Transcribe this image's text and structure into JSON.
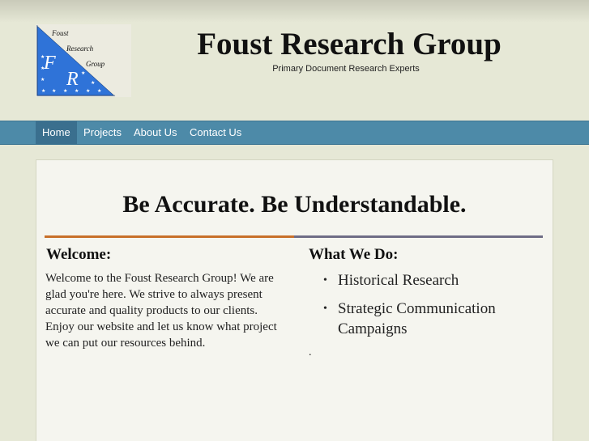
{
  "header": {
    "logo_letters": [
      "F",
      "R"
    ],
    "logo_words": [
      "Foust",
      "Research",
      "Group"
    ],
    "title": "Foust Research Group",
    "tagline": "Primary Document Research Experts"
  },
  "nav": {
    "items": [
      {
        "label": "Home",
        "active": true
      },
      {
        "label": "Projects",
        "active": false
      },
      {
        "label": "About Us",
        "active": false
      },
      {
        "label": "Contact Us",
        "active": false
      }
    ]
  },
  "main": {
    "headline": "Be Accurate.  Be Understandable.",
    "welcome": {
      "heading": "Welcome:",
      "text": "Welcome to the Foust Research Group!  We are glad you're here.  We strive to always present accurate and quality products to our clients.  Enjoy our website and let us know what project we can put our resources behind."
    },
    "what_we_do": {
      "heading": "What We Do:",
      "items": [
        "Historical Research",
        "Strategic Communication Campaigns"
      ],
      "trailing": "."
    }
  },
  "colors": {
    "nav_bar": "#4d8aa8",
    "nav_active": "#3a6f8e",
    "divider_left": "#c8702a",
    "divider_right": "#6f6d86",
    "logo_blue": "#2f73d8"
  }
}
